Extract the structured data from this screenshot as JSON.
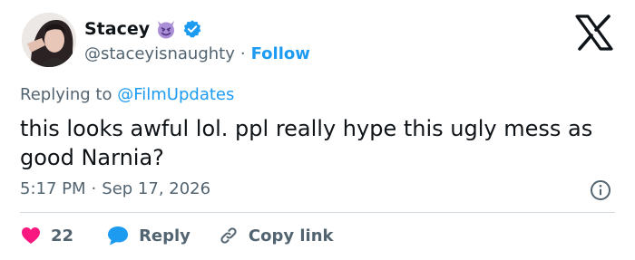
{
  "author": {
    "name": "Stacey",
    "handle": "@staceyisnaughty",
    "separator": "·",
    "follow_label": "Follow",
    "emoji_icon": "smiling-devil-icon",
    "verified_icon": "verified-badge-icon"
  },
  "brand": {
    "logo_icon": "x-logo-icon"
  },
  "reply_context": {
    "prefix": "Replying to",
    "mention": "@FilmUpdates"
  },
  "tweet": {
    "text": "this looks awful lol. ppl really hype this ugly mess as good Narnia?",
    "time": "5:17 PM",
    "separator": "·",
    "date": "Sep 17, 2026"
  },
  "actions": {
    "like_count": "22",
    "reply_label": "Reply",
    "copy_link_label": "Copy link"
  },
  "colors": {
    "accent": "#1d9bf0",
    "like": "#f91880",
    "muted": "#536471",
    "text": "#0f1419",
    "emoji_purple": "#aa8ed6"
  }
}
